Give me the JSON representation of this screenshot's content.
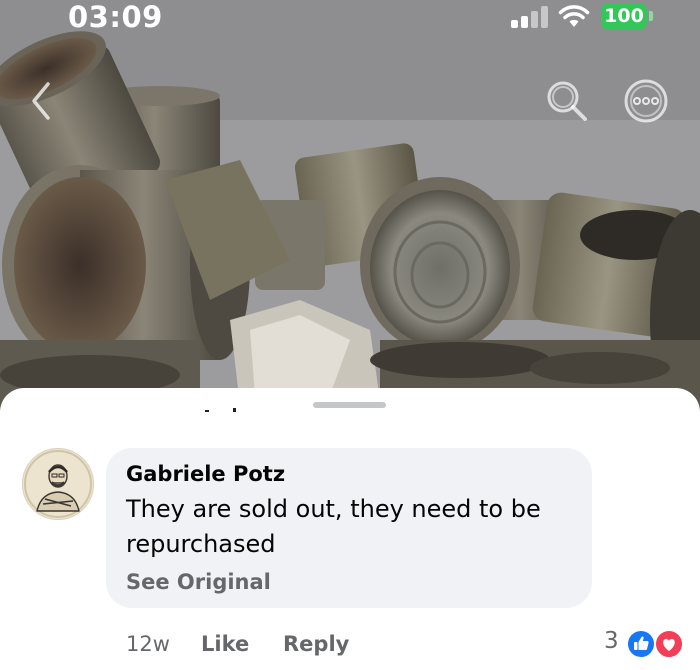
{
  "status_bar": {
    "time": "03:09",
    "battery": "100"
  },
  "nav": {
    "back_icon": "chevron-left-icon",
    "search_icon": "search-icon",
    "more_icon": "more-dots-icon"
  },
  "comment": {
    "author": "Gabriele Potz",
    "text": "They are sold out, they need to be repurchased",
    "see_original": "See Original",
    "time_ago": "12w",
    "like_label": "Like",
    "reply_label": "Reply",
    "reaction_count": "3",
    "reactions": [
      "like-reaction-icon",
      "love-reaction-icon"
    ]
  },
  "colors": {
    "battery": "#33c75a",
    "bubble": "#f0f2f5",
    "meta_text": "#65676b",
    "like_blue": "#1877f2",
    "love_red": "#f33e58"
  }
}
